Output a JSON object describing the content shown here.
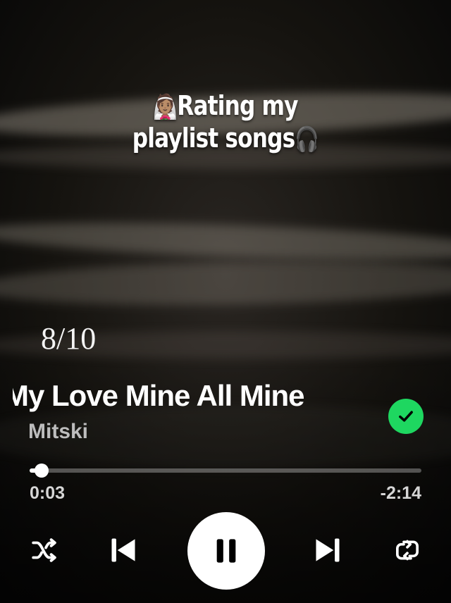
{
  "overlay": {
    "title_line1": "Rating my",
    "title_line2": "playlist songs",
    "title_emoji_start": "👰🏽",
    "title_emoji_end": "🎧",
    "rating": "8/10"
  },
  "player": {
    "song_title": "My Love Mine All Mine",
    "artist": "Mitski",
    "elapsed": "0:03",
    "remaining": "-2:14",
    "progress_fraction": 0.03,
    "liked": true,
    "state": "playing"
  },
  "icons": {
    "liked": "check-circle-icon",
    "shuffle": "shuffle-icon",
    "previous": "skip-previous-icon",
    "pause": "pause-icon",
    "next": "skip-next-icon",
    "repeat": "repeat-icon"
  },
  "colors": {
    "accent_green": "#1ed760",
    "text_primary": "#ffffff",
    "text_secondary": "#bdbdbd"
  }
}
